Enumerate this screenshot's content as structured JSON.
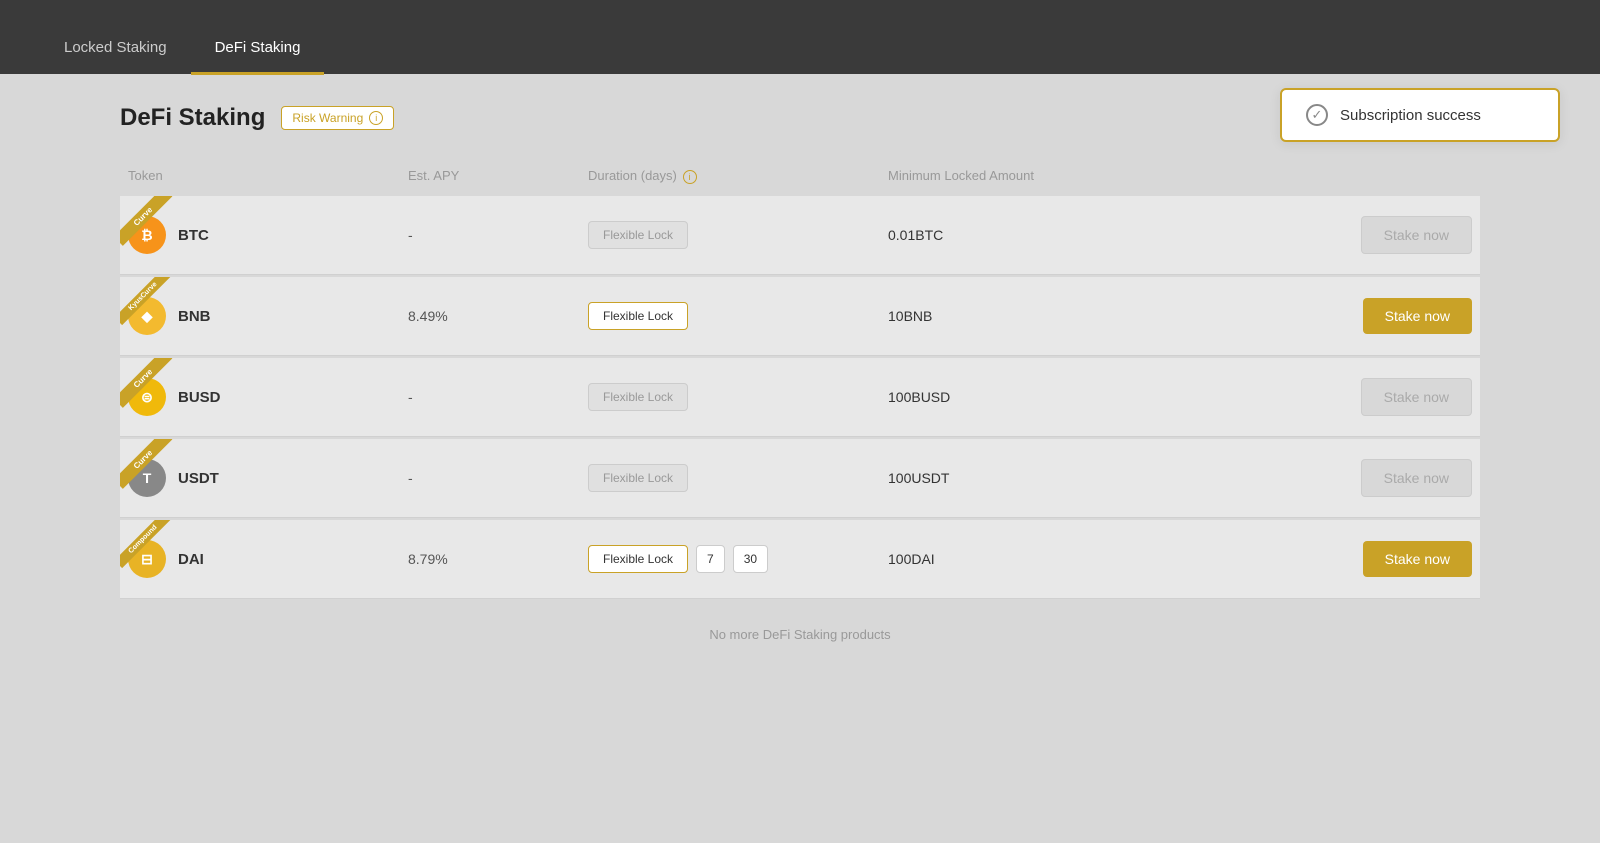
{
  "nav": {
    "tabs": [
      {
        "id": "locked-staking",
        "label": "Locked Staking",
        "active": false
      },
      {
        "id": "defi-staking",
        "label": "DeFi Staking",
        "active": true
      }
    ]
  },
  "page": {
    "title": "DeFi Staking",
    "risk_warning_label": "Risk Warning"
  },
  "table": {
    "headers": {
      "token": "Token",
      "est_apy": "Est. APY",
      "duration": "Duration (days)",
      "min_locked": "Minimum Locked Amount"
    },
    "rows": [
      {
        "id": "btc",
        "ribbon": "Curve",
        "token_symbol": "BTC",
        "token_icon_type": "btc",
        "est_apy": "-",
        "duration_flexible": "Flexible Lock",
        "duration_flexible_active": false,
        "duration_nums": [],
        "min_locked": "0.01BTC",
        "stake_label": "Stake now",
        "stake_active": false
      },
      {
        "id": "bnb",
        "ribbon": "KyusCurve",
        "token_symbol": "BNB",
        "token_icon_type": "bnb",
        "est_apy": "8.49%",
        "duration_flexible": "Flexible Lock",
        "duration_flexible_active": true,
        "duration_nums": [],
        "min_locked": "10BNB",
        "stake_label": "Stake now",
        "stake_active": true
      },
      {
        "id": "busd",
        "ribbon": "Curve",
        "token_symbol": "BUSD",
        "token_icon_type": "busd",
        "est_apy": "-",
        "duration_flexible": "Flexible Lock",
        "duration_flexible_active": false,
        "duration_nums": [],
        "min_locked": "100BUSD",
        "stake_label": "Stake now",
        "stake_active": false
      },
      {
        "id": "usdt",
        "ribbon": "Curve",
        "token_symbol": "USDT",
        "token_icon_type": "usdt",
        "est_apy": "-",
        "duration_flexible": "Flexible Lock",
        "duration_flexible_active": false,
        "duration_nums": [],
        "min_locked": "100USDT",
        "stake_label": "Stake now",
        "stake_active": false
      },
      {
        "id": "dai",
        "ribbon": "Compound",
        "token_symbol": "DAI",
        "token_icon_type": "dai",
        "est_apy": "8.79%",
        "duration_flexible": "Flexible Lock",
        "duration_flexible_active": true,
        "duration_nums": [
          "7",
          "30"
        ],
        "min_locked": "100DAI",
        "stake_label": "Stake now",
        "stake_active": true
      }
    ]
  },
  "footer": {
    "no_more_label": "No more DeFi Staking products"
  },
  "toast": {
    "message": "Subscription success"
  },
  "icons": {
    "btc_symbol": "₿",
    "bnb_symbol": "◆",
    "busd_symbol": "⊜",
    "usdt_symbol": "T",
    "dai_symbol": "⊟"
  }
}
